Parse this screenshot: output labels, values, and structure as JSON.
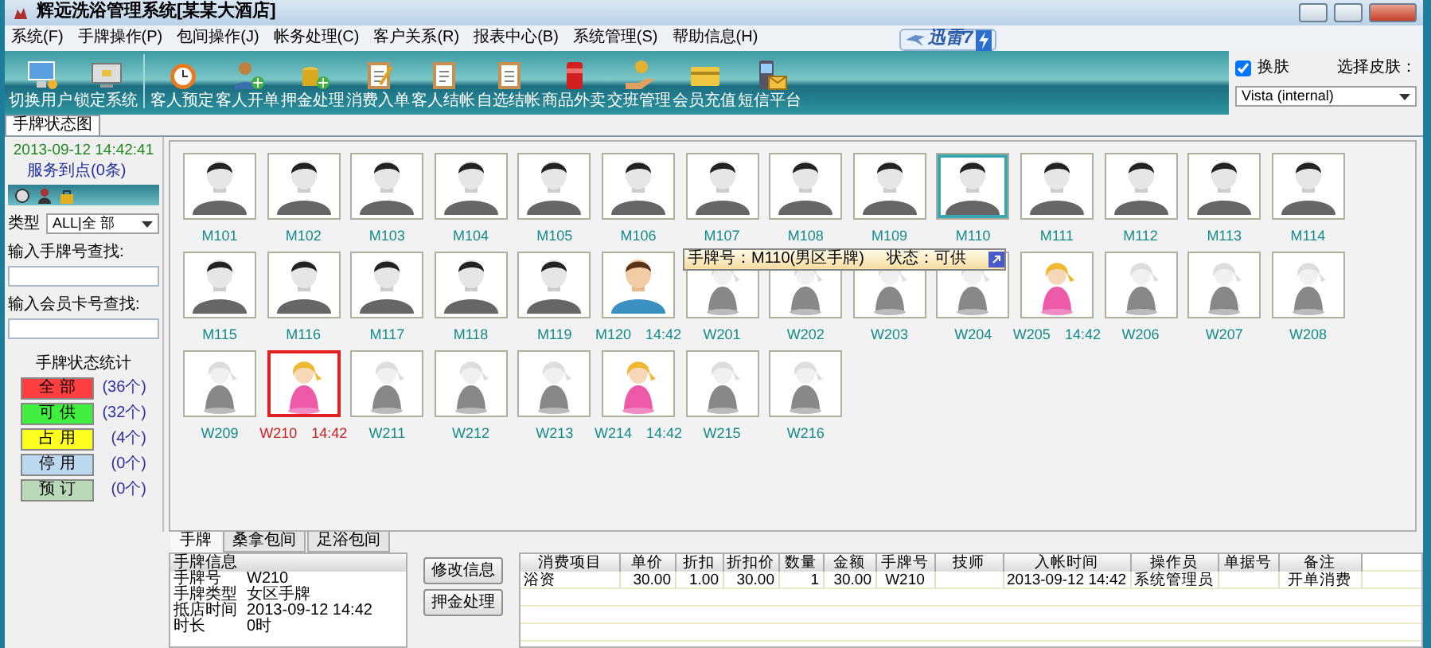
{
  "window": {
    "title": "辉远洗浴管理系统[某某大酒店]"
  },
  "menu": [
    "系统(F)",
    "手牌操作(P)",
    "包间操作(J)",
    "帐务处理(C)",
    "客户关系(R)",
    "报表中心(B)",
    "系统管理(S)",
    "帮助信息(H)"
  ],
  "ad_badge": {
    "text": "迅雷7"
  },
  "toolbar": {
    "system": [
      "切换用户",
      "锁定系统"
    ],
    "business": [
      "客人预定",
      "客人开单",
      "押金处理",
      "消费入单",
      "客人结帐",
      "自选结帐",
      "商品外卖",
      "交班管理",
      "会员充值",
      "短信平台"
    ]
  },
  "skin": {
    "toggle_label": "换肤",
    "enabled": true,
    "select_label": "选择皮肤：",
    "value": "Vista (internal)"
  },
  "main_tabs": [
    {
      "label": "手牌状态图",
      "selected": true
    }
  ],
  "sidebar": {
    "datetime": "2013-09-12 14:42:41",
    "service_link": "服务到点(0条)",
    "type_label": "类型",
    "type_value": "ALL|全 部",
    "card_search_label": "输入手牌号查找:",
    "member_search_label": "输入会员卡号查找:",
    "stats_title": "手牌状态统计",
    "stats": [
      {
        "label": "全 部",
        "count": "(36个)",
        "color": "#ff4040"
      },
      {
        "label": "可 供",
        "count": "(32个)",
        "color": "#40ee40"
      },
      {
        "label": "占 用",
        "count": "(4个)",
        "color": "#ffff20"
      },
      {
        "label": "停 用",
        "count": "(0个)",
        "color": "#bcd8f0"
      },
      {
        "label": "预 订",
        "count": "(0个)",
        "color": "#b8d8b8"
      }
    ]
  },
  "cards": [
    {
      "label": "M101",
      "kind": "male",
      "occupied": false,
      "selected": false,
      "hovered": false
    },
    {
      "label": "M102",
      "kind": "male",
      "occupied": false,
      "selected": false,
      "hovered": false
    },
    {
      "label": "M103",
      "kind": "male",
      "occupied": false,
      "selected": false,
      "hovered": false
    },
    {
      "label": "M104",
      "kind": "male",
      "occupied": false,
      "selected": false,
      "hovered": false
    },
    {
      "label": "M105",
      "kind": "male",
      "occupied": false,
      "selected": false,
      "hovered": false
    },
    {
      "label": "M106",
      "kind": "male",
      "occupied": false,
      "selected": false,
      "hovered": false
    },
    {
      "label": "M107",
      "kind": "male",
      "occupied": false,
      "selected": false,
      "hovered": false
    },
    {
      "label": "M108",
      "kind": "male",
      "occupied": false,
      "selected": false,
      "hovered": false
    },
    {
      "label": "M109",
      "kind": "male",
      "occupied": false,
      "selected": false,
      "hovered": false
    },
    {
      "label": "M110",
      "kind": "male",
      "occupied": false,
      "selected": false,
      "hovered": true
    },
    {
      "label": "M111",
      "kind": "male",
      "occupied": false,
      "selected": false,
      "hovered": false
    },
    {
      "label": "M112",
      "kind": "male",
      "occupied": false,
      "selected": false,
      "hovered": false
    },
    {
      "label": "M113",
      "kind": "male",
      "occupied": false,
      "selected": false,
      "hovered": false
    },
    {
      "label": "M114",
      "kind": "male",
      "occupied": false,
      "selected": false,
      "hovered": false
    },
    {
      "label": "M115",
      "kind": "male",
      "occupied": false,
      "selected": false,
      "hovered": false
    },
    {
      "label": "M116",
      "kind": "male",
      "occupied": false,
      "selected": false,
      "hovered": false
    },
    {
      "label": "M117",
      "kind": "male",
      "occupied": false,
      "selected": false,
      "hovered": false
    },
    {
      "label": "M118",
      "kind": "male",
      "occupied": false,
      "selected": false,
      "hovered": false
    },
    {
      "label": "M119",
      "kind": "male",
      "occupied": false,
      "selected": false,
      "hovered": false
    },
    {
      "label": "M120",
      "time": "14:42",
      "kind": "male",
      "occupied": true,
      "selected": false,
      "hovered": false
    },
    {
      "label": "W201",
      "kind": "female",
      "occupied": false,
      "selected": false,
      "hovered": false
    },
    {
      "label": "W202",
      "kind": "female",
      "occupied": false,
      "selected": false,
      "hovered": false
    },
    {
      "label": "W203",
      "kind": "female",
      "occupied": false,
      "selected": false,
      "hovered": false
    },
    {
      "label": "W204",
      "kind": "female",
      "occupied": false,
      "selected": false,
      "hovered": false
    },
    {
      "label": "W205",
      "time": "14:42",
      "kind": "female",
      "occupied": true,
      "selected": false,
      "hovered": false
    },
    {
      "label": "W206",
      "kind": "female",
      "occupied": false,
      "selected": false,
      "hovered": false
    },
    {
      "label": "W207",
      "kind": "female",
      "occupied": false,
      "selected": false,
      "hovered": false
    },
    {
      "label": "W208",
      "kind": "female",
      "occupied": false,
      "selected": false,
      "hovered": false
    },
    {
      "label": "W209",
      "kind": "female",
      "occupied": false,
      "selected": false,
      "hovered": false
    },
    {
      "label": "W210",
      "time": "14:42",
      "kind": "female",
      "occupied": true,
      "selected": true,
      "hovered": false
    },
    {
      "label": "W211",
      "kind": "female",
      "occupied": false,
      "selected": false,
      "hovered": false
    },
    {
      "label": "W212",
      "kind": "female",
      "occupied": false,
      "selected": false,
      "hovered": false
    },
    {
      "label": "W213",
      "kind": "female",
      "occupied": false,
      "selected": false,
      "hovered": false
    },
    {
      "label": "W214",
      "time": "14:42",
      "kind": "female",
      "occupied": true,
      "selected": false,
      "hovered": false
    },
    {
      "label": "W215",
      "kind": "female",
      "occupied": false,
      "selected": false,
      "hovered": false
    },
    {
      "label": "W216",
      "kind": "female",
      "occupied": false,
      "selected": false,
      "hovered": false
    }
  ],
  "tooltip": {
    "card": "手牌号：M110(男区手牌)",
    "status": "状态：可供"
  },
  "bottom_tabs": [
    {
      "label": "手牌",
      "selected": true
    },
    {
      "label": "桑拿包间",
      "selected": false
    },
    {
      "label": "足浴包间",
      "selected": false
    }
  ],
  "card_info": {
    "title": "手牌信息",
    "fields": [
      {
        "label": "手牌号",
        "value": "W210"
      },
      {
        "label": "手牌类型",
        "value": "女区手牌"
      },
      {
        "label": "抵店时间",
        "value": "2013-09-12 14:42"
      },
      {
        "label": "时长",
        "value": "0时"
      }
    ]
  },
  "actions": [
    "修改信息",
    "押金处理"
  ],
  "table": {
    "columns": [
      "消费项目",
      "单价",
      "折扣",
      "折扣价",
      "数量",
      "金额",
      "手牌号",
      "技师",
      "入帐时间",
      "操作员",
      "单据号",
      "备注"
    ],
    "rows": [
      [
        "浴资",
        "30.00",
        "1.00",
        "30.00",
        "1",
        "30.00",
        "W210",
        null,
        "2013-09-12 14:42",
        "系统管理员",
        null,
        "开单消费"
      ]
    ]
  }
}
